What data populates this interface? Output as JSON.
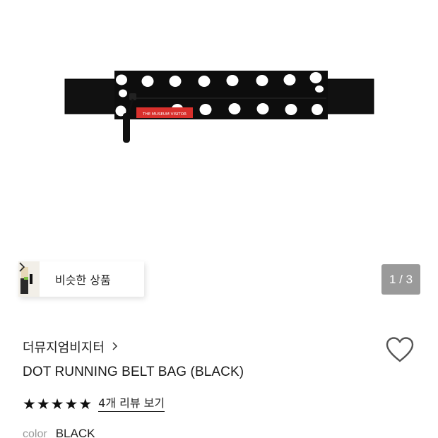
{
  "gallery": {
    "product_logo_text": "THE MUSEUM VISITOR",
    "similar_label": "비슷한 상품",
    "counter": "1 / 3",
    "current_image": 1,
    "total_images": 3
  },
  "product": {
    "brand": "더뮤지엄비지터",
    "title": "DOT RUNNING BELT BAG (BLACK)",
    "rating_stars": 5,
    "review_link": "4개 리뷰 보기",
    "color_label": "color",
    "color_value": "BLACK"
  },
  "icons": {
    "brand_chevron": "chevron-right-icon",
    "similar_chevron": "chevron-right-icon",
    "wishlist": "heart-outline-icon",
    "rating": "star-filled-icon"
  },
  "colors": {
    "bag_body": "#0d0d0d",
    "dot": "#ffffff",
    "label_red": "#d9302c",
    "counter_bg": "#9a9a9a"
  }
}
